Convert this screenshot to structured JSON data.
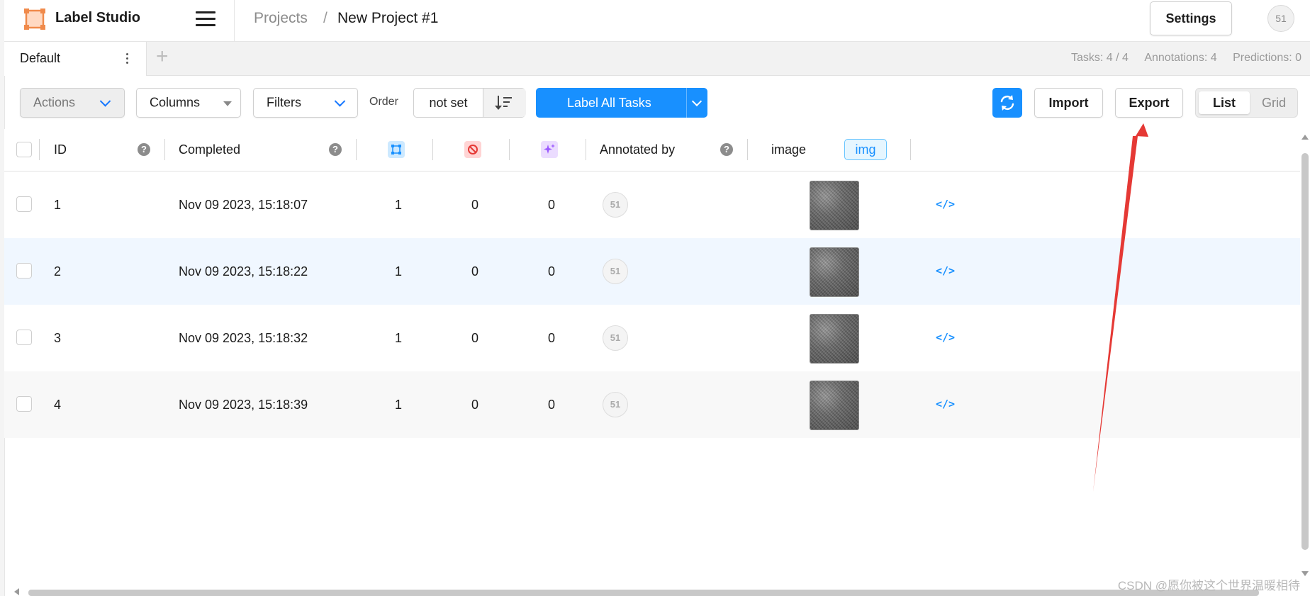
{
  "header": {
    "app_title": "Label Studio",
    "breadcrumb": {
      "projects": "Projects",
      "separator": "/",
      "current": "New Project #1"
    },
    "settings_label": "Settings",
    "user_avatar": "51"
  },
  "tabs": {
    "items": [
      {
        "label": "Default"
      }
    ],
    "add_label": "+",
    "stats": {
      "tasks": "Tasks: 4 / 4",
      "annotations": "Annotations: 4",
      "predictions": "Predictions: 0"
    }
  },
  "toolbar": {
    "actions_label": "Actions",
    "columns_label": "Columns",
    "filters_label": "Filters",
    "order_label": "Order",
    "order_value": "not set",
    "label_all_label": "Label All Tasks",
    "import_label": "Import",
    "export_label": "Export",
    "view_list": "List",
    "view_grid": "Grid",
    "accent_color": "#1890ff"
  },
  "table": {
    "columns": {
      "id": "ID",
      "completed": "Completed",
      "annotations_icon": "annotations-icon",
      "cancelled_icon": "cancelled-icon",
      "predictions_icon": "predictions-icon",
      "annotated_by": "Annotated by",
      "image": "image",
      "image_badge": "img"
    },
    "rows": [
      {
        "id": "1",
        "completed": "Nov 09 2023, 15:18:07",
        "annotations": "1",
        "cancelled": "0",
        "predictions": "0",
        "annotator": "51"
      },
      {
        "id": "2",
        "completed": "Nov 09 2023, 15:18:22",
        "annotations": "1",
        "cancelled": "0",
        "predictions": "0",
        "annotator": "51"
      },
      {
        "id": "3",
        "completed": "Nov 09 2023, 15:18:32",
        "annotations": "1",
        "cancelled": "0",
        "predictions": "0",
        "annotator": "51"
      },
      {
        "id": "4",
        "completed": "Nov 09 2023, 15:18:39",
        "annotations": "1",
        "cancelled": "0",
        "predictions": "0",
        "annotator": "51"
      }
    ],
    "row_colors": {
      "highlight": "#f0f7ff",
      "alt": "#f8f8f8"
    }
  },
  "watermark": "CSDN @愿你被这个世界温暖相待"
}
